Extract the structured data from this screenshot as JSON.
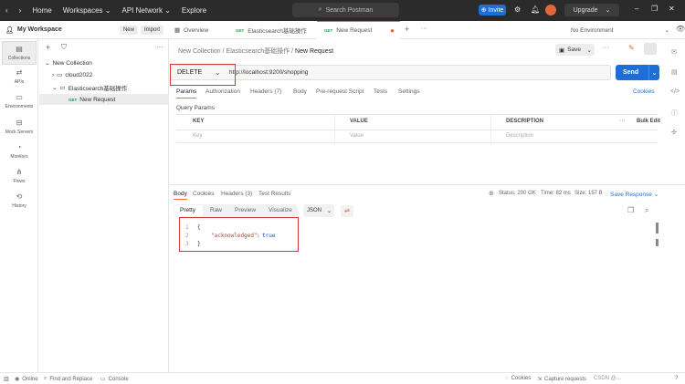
{
  "topbar": {
    "home": "Home",
    "workspaces": "Workspaces",
    "api_network": "API Network",
    "explore": "Explore",
    "search_placeholder": "Search Postman",
    "invite": "Invite",
    "upgrade": "Upgrade"
  },
  "sidebar": {
    "workspace": "My Workspace",
    "new_label": "New",
    "import_label": "Import",
    "rail": [
      {
        "label": "Collections",
        "icon": "collections-icon"
      },
      {
        "label": "APIs",
        "icon": "apis-icon"
      },
      {
        "label": "Environments",
        "icon": "environments-icon"
      },
      {
        "label": "Mock Servers",
        "icon": "mock-servers-icon"
      },
      {
        "label": "Monitors",
        "icon": "monitors-icon"
      },
      {
        "label": "Flows",
        "icon": "flows-icon"
      },
      {
        "label": "History",
        "icon": "history-icon"
      }
    ],
    "tree": {
      "collection": "New Collection",
      "folder1": "cloud2022",
      "folder2": "Elasticsearch基础操作",
      "request_method": "GET",
      "request": "New Request"
    }
  },
  "tabs": {
    "overview": "Overview",
    "get_method": "GET",
    "es_tab": "Elasticsearch基础操作",
    "req_method": "GET",
    "req_tab": "New Request",
    "environment": "No Environment"
  },
  "request": {
    "breadcrumb": {
      "a": "New Collection",
      "b": "Elasticsearch基础操作",
      "c": "New Request"
    },
    "save": "Save",
    "method": "DELETE",
    "url": "http://localhost:9200/shopping",
    "send": "Send",
    "subtabs": [
      "Params",
      "Authorization",
      "Headers (7)",
      "Body",
      "Pre-request Script",
      "Tests",
      "Settings"
    ],
    "cookies": "Cookies",
    "query_params": "Query Params",
    "headers": {
      "key": "KEY",
      "value": "VALUE",
      "description": "DESCRIPTION",
      "bulk": "Bulk Edit"
    },
    "placeholders": {
      "key": "Key",
      "value": "Value",
      "description": "Description"
    }
  },
  "response": {
    "tabs": [
      "Body",
      "Cookies",
      "Headers (3)",
      "Test Results"
    ],
    "status": "Status: 200 OK",
    "time": "Time: 82 ms",
    "size": "Size: 157 B",
    "save_response": "Save Response",
    "views": [
      "Pretty",
      "Raw",
      "Preview",
      "Visualize"
    ],
    "format": "JSON",
    "lines": [
      "1",
      "2",
      "3"
    ],
    "code": {
      "open": "{",
      "key": "\"acknowledged\"",
      "colon": ":",
      "value": "true",
      "close": "}"
    }
  },
  "statusbar": {
    "online": "Online",
    "find_replace": "Find and Replace",
    "console": "Console",
    "cookies": "Cookies",
    "capture": "Capture requests",
    "watermark": "CSDN @…"
  },
  "colors": {
    "accent": "#1c6ed8",
    "highlight": "#d9383a",
    "active_tab": "#ff6c37"
  }
}
